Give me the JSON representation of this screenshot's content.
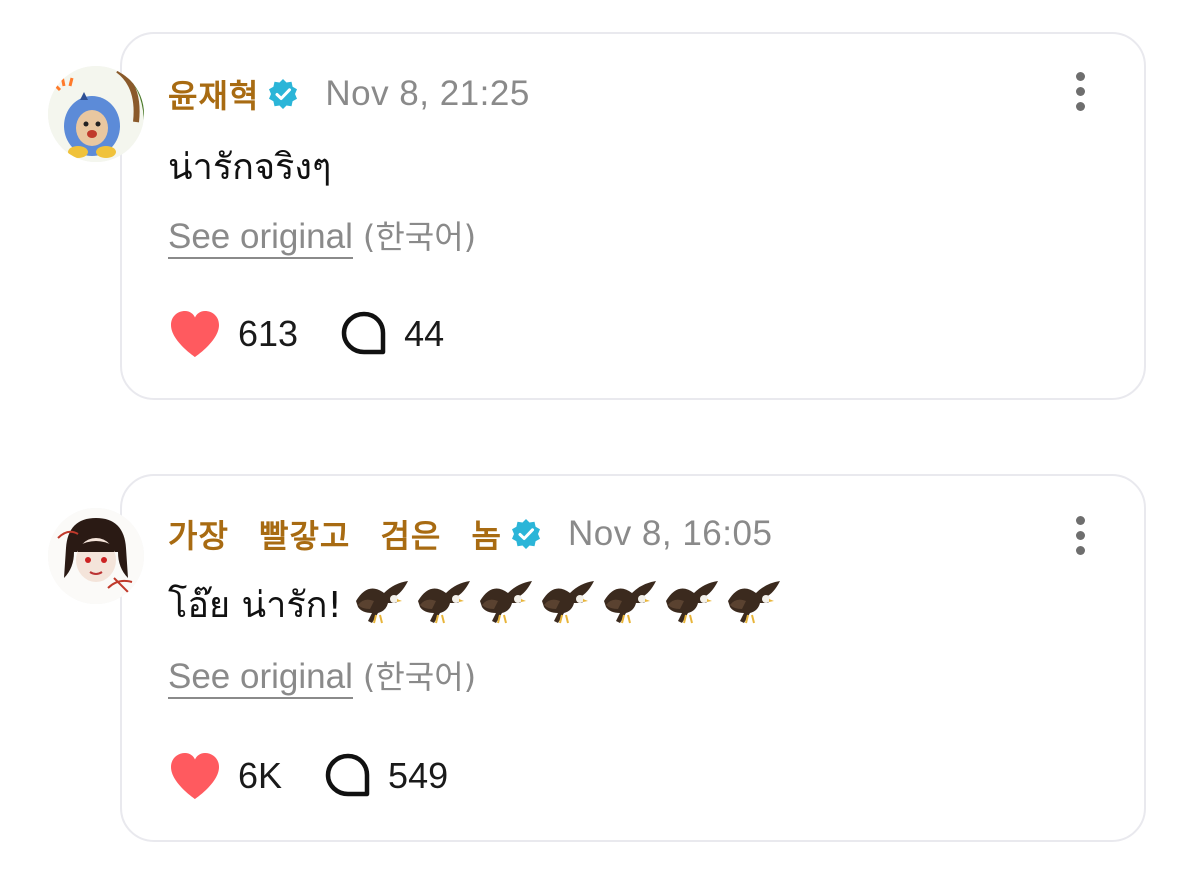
{
  "comments": [
    {
      "username": "윤재혁",
      "verified": true,
      "timestamp": "Nov 8, 21:25",
      "text": "น่ารักจริงๆ",
      "emoji": [],
      "see_original": "See original",
      "language": "(한국어)",
      "likes": "613",
      "replies": "44",
      "avatar_icon": "cartoon-bird-costume-avatar"
    },
    {
      "username": "가장 빨갛고 검은 놈",
      "verified": true,
      "timestamp": "Nov 8, 16:05",
      "text": "โอ๊ย น่ารัก!",
      "emoji": [
        "eagle",
        "eagle",
        "eagle",
        "eagle",
        "eagle",
        "eagle",
        "eagle"
      ],
      "see_original": "See original",
      "language": "(한국어)",
      "likes": "6K",
      "replies": "549",
      "avatar_icon": "sketch-portrait-avatar"
    }
  ],
  "colors": {
    "username": "#a86b12",
    "verified_badge": "#2bb5d8",
    "heart": "#ff5a5f",
    "muted_text": "#8a8a8a"
  }
}
